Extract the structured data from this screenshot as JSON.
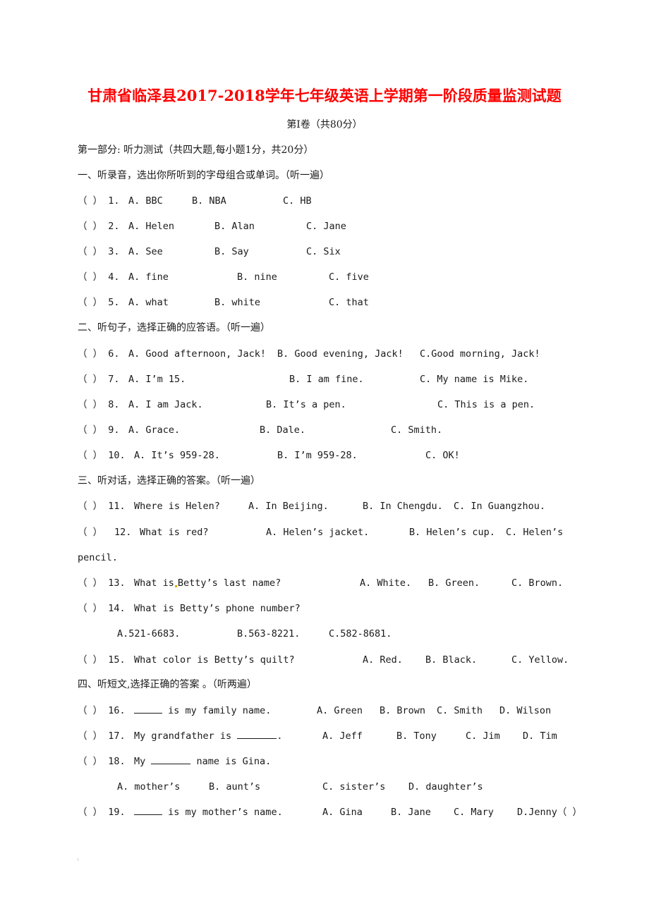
{
  "title": "甘肃省临泽县2017-2018学年七年级英语上学期第一阶段质量监测试题",
  "volume": "第Ⅰ卷（共80分）",
  "part_one": "第一部分:   听力测试（共四大题,每小题1分，共20分）",
  "sections": [
    {
      "heading": "一、听录音，选出你所听到的字母组合或单词。（听一遍）",
      "questions": [
        {
          "paren": "（  ）",
          "num": "1.",
          "stem": "",
          "options": [
            "A.  BBC",
            "B.  NBA",
            "C.  HB"
          ]
        },
        {
          "paren": "（  ）",
          "num": "2.",
          "stem": "",
          "options": [
            "A.  Helen",
            "B.  Alan",
            "C.  Jane"
          ]
        },
        {
          "paren": "（  ）",
          "num": "3.",
          "stem": "",
          "options": [
            "A.  See",
            "B.  Say",
            "C.  Six"
          ]
        },
        {
          "paren": "（  ）",
          "num": "4.",
          "stem": "",
          "options": [
            "A.  fine",
            "B.  nine",
            "C.  five"
          ]
        },
        {
          "paren": "（  ）",
          "num": "5.",
          "stem": "",
          "options": [
            "A.  what",
            "B.  white",
            "C.  that"
          ]
        }
      ]
    },
    {
      "heading": "二、听句子，选择正确的应答语。（听一遍）",
      "questions": [
        {
          "paren": "（  ）",
          "num": "6.",
          "stem": "",
          "options": [
            "A.  Good afternoon,  Jack!",
            "B.  Good evening,  Jack!",
            "C.Good morning,  Jack!"
          ]
        },
        {
          "paren": "（  ）",
          "num": "7.",
          "stem": "",
          "options": [
            "A.  I’m 15.",
            "B.  I am fine.",
            "C.  My name is Mike."
          ]
        },
        {
          "paren": "（  ）",
          "num": "8.",
          "stem": "",
          "options": [
            "A.  I am Jack.",
            "B.  It’s a pen.",
            "C.  This is a pen."
          ]
        },
        {
          "paren": "（  ）",
          "num": "9.",
          "stem": "",
          "options": [
            "A.  Grace.",
            "B.  Dale.",
            "C.  Smith."
          ]
        },
        {
          "paren": "（  ）",
          "num": "10.",
          "stem": "",
          "options": [
            "A.  It’s 959-28.",
            "B.  I’m 959-28.",
            "C.  OK!"
          ]
        }
      ]
    },
    {
      "heading": "三、听对话，选择正确的答案。（听一遍）",
      "questions": [
        {
          "paren": "（  ）",
          "num": "11.",
          "stem": "Where is Helen?",
          "options": [
            "A.  In Beijing.",
            "B.  In Chengdu.",
            "C.  In Guangzhou."
          ]
        },
        {
          "paren": "（  ）",
          "num": "12.",
          "stem": "What is red?",
          "options": [
            "A.  Helen’s jacket.",
            "B.  Helen’s cup.",
            "C.  Helen’s"
          ],
          "continuation": "pencil."
        },
        {
          "paren": "（  ）",
          "num": "13.",
          "stem_a": "What is",
          "stem_b": "Betty’s last name?",
          "options": [
            "A.  White.",
            "B.  Green.",
            "C.  Brown."
          ]
        },
        {
          "paren": "（  ）",
          "num": "14.",
          "stem": "What is Betty’s phone number?",
          "options": [
            "A.521-6683.",
            "B.563-8221.",
            "C.582-8681."
          ]
        },
        {
          "paren": "（  ）",
          "num": "15.",
          "stem": "What color is Betty’s quilt?",
          "options": [
            "A.  Red.",
            "B.  Black.",
            "C.  Yellow."
          ]
        }
      ]
    },
    {
      "heading": "四、听短文,选择正确的答案 。（听两遍）",
      "questions": [
        {
          "paren": "（  ）",
          "num": "16.",
          "stem": "is my family name.",
          "options": [
            "A.  Green",
            "B.  Brown",
            "C.  Smith",
            "D.  Wilson"
          ]
        },
        {
          "paren": "（  ）",
          "num": "17.",
          "stem": "My grandfather is",
          "stem_end": ".",
          "options": [
            "A.  Jeff",
            "B.  Tony",
            "C.  Jim",
            "D.  Tim"
          ]
        },
        {
          "paren": "（  ）",
          "num": "18.",
          "stem_a": "My",
          "stem_b": "name is Gina.",
          "options": [
            "A.  mother’s",
            "B.  aunt’s",
            "C.  sister’s",
            "D.  daughter’s"
          ]
        },
        {
          "paren": "（  ）",
          "num": "19.",
          "stem": "is my mother’s name.",
          "options": [
            "A.  Gina",
            "B.  Jane",
            "C.  Mary",
            "D.Jenny（  ）"
          ]
        }
      ]
    }
  ],
  "colors": {
    "title": "#ff0000",
    "text": "#1a1a1a"
  }
}
